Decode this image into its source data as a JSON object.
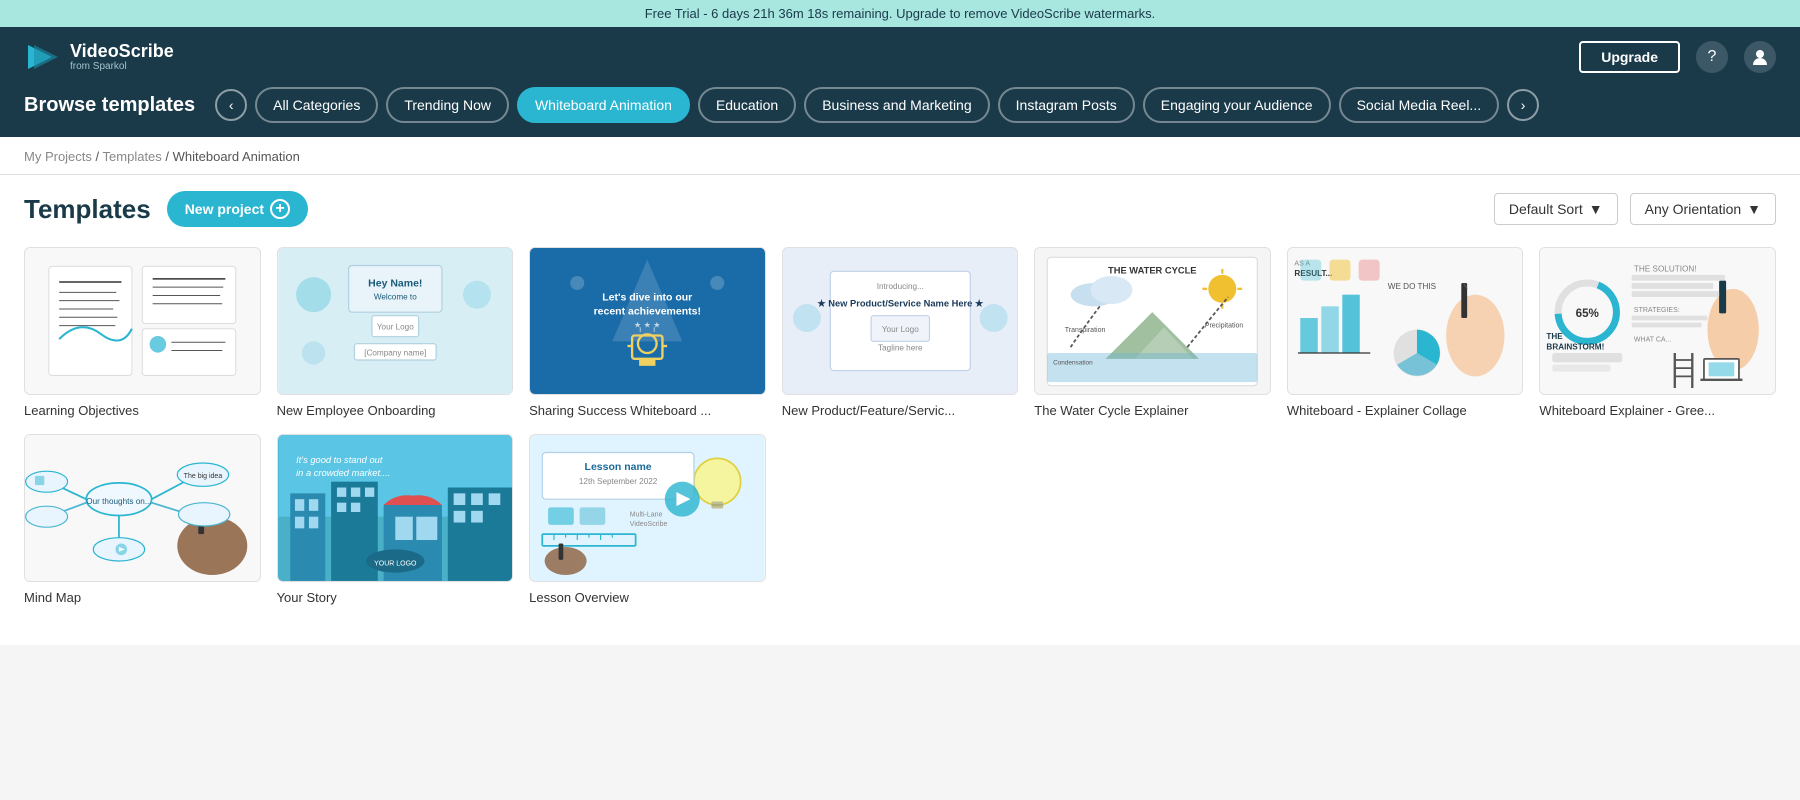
{
  "banner": {
    "text": "Free Trial - 6 days 21h 36m 18s remaining. Upgrade to remove VideoScribe watermarks."
  },
  "header": {
    "logo_name": "VideoScribe",
    "logo_sub": "from Sparkol",
    "upgrade_label": "Upgrade",
    "help_icon": "?",
    "account_icon": "👤"
  },
  "nav": {
    "browse_title": "Browse templates",
    "categories": [
      {
        "id": "all",
        "label": "All Categories",
        "active": false
      },
      {
        "id": "trending",
        "label": "Trending Now",
        "active": false
      },
      {
        "id": "whiteboard",
        "label": "Whiteboard Animation",
        "active": true
      },
      {
        "id": "education",
        "label": "Education",
        "active": false
      },
      {
        "id": "business",
        "label": "Business and Marketing",
        "active": false
      },
      {
        "id": "instagram",
        "label": "Instagram Posts",
        "active": false
      },
      {
        "id": "engaging",
        "label": "Engaging your Audience",
        "active": false
      },
      {
        "id": "social",
        "label": "Social Media Reel...",
        "active": false
      }
    ]
  },
  "breadcrumb": {
    "items": [
      "My Projects",
      "Templates",
      "Whiteboard Animation"
    ]
  },
  "content": {
    "title": "Templates",
    "new_project_label": "New project",
    "sort_label": "Default Sort",
    "orientation_label": "Any Orientation"
  },
  "templates_row1": [
    {
      "id": "learning",
      "name": "Learning Objectives",
      "thumb_type": "learning"
    },
    {
      "id": "onboarding",
      "name": "New Employee Onboarding",
      "thumb_type": "onboarding"
    },
    {
      "id": "sharing",
      "name": "Sharing Success Whiteboard ...",
      "thumb_type": "sharing"
    },
    {
      "id": "product",
      "name": "New Product/Feature/Servic...",
      "thumb_type": "product"
    },
    {
      "id": "water",
      "name": "The Water Cycle Explainer",
      "thumb_type": "water"
    },
    {
      "id": "collage",
      "name": "Whiteboard - Explainer Collage",
      "thumb_type": "explainer"
    },
    {
      "id": "brainstorm",
      "name": "Whiteboard Explainer - Gree...",
      "thumb_type": "brainstorm"
    }
  ],
  "templates_row2": [
    {
      "id": "mindmap",
      "name": "Mind Map",
      "thumb_type": "mindmap"
    },
    {
      "id": "yourstory",
      "name": "Your Story",
      "thumb_type": "yourstory"
    },
    {
      "id": "lesson",
      "name": "Lesson Overview",
      "thumb_type": "lesson"
    }
  ]
}
